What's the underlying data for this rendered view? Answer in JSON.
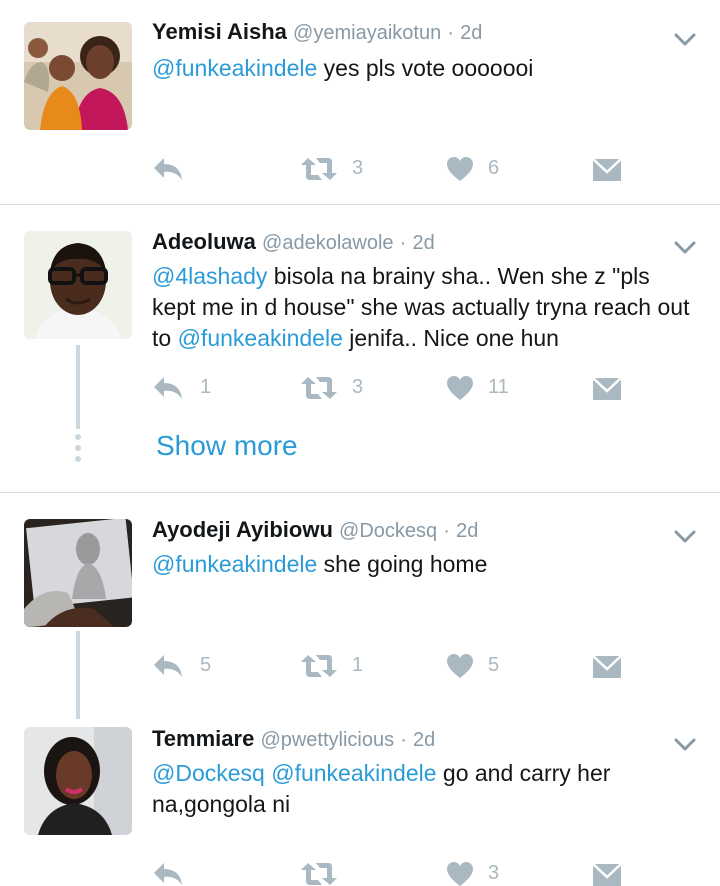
{
  "tweets": [
    {
      "name": "Yemisi Aisha",
      "handle": "@yemiayaikotun",
      "separator": "·",
      "time": "2d",
      "mentions": [
        "@funkeakindele"
      ],
      "text": " yes pls vote ooooooi",
      "reply_count": "",
      "retweet_count": "3",
      "like_count": "6"
    },
    {
      "name": "Adeoluwa",
      "handle": "@adekolawole",
      "separator": "·",
      "time": "2d",
      "mention_1": "@4lashady",
      "text_1": " bisola na brainy sha.. Wen she z \"pls kept me in d house\" she was actually tryna reach out to ",
      "mention_2": "@funkeakindele",
      "text_2": " jenifa.. Nice one hun",
      "reply_count": "1",
      "retweet_count": "3",
      "like_count": "11"
    },
    {
      "name": "Ayodeji Ayibiowu",
      "handle": "@Dockesq",
      "separator": "·",
      "time": "2d",
      "mention_1": "@funkeakindele",
      "text_1": " she going home",
      "reply_count": "5",
      "retweet_count": "1",
      "like_count": "5"
    },
    {
      "name": "Temmiare",
      "handle": "@pwettylicious",
      "separator": "·",
      "time": "2d",
      "mention_1": "@Dockesq",
      "mention_2": "@funkeakindele",
      "text_1": " go and carry her na,gongola ni",
      "reply_count": "",
      "retweet_count": "",
      "like_count": "3"
    }
  ],
  "show_more_label": "Show more",
  "colors": {
    "accent": "#2b9bd8",
    "icon": "#aab8c2",
    "divider": "#d9dfe4"
  },
  "icons": [
    "reply-icon",
    "retweet-icon",
    "like-icon",
    "direct-message-icon",
    "caret-down-icon"
  ]
}
